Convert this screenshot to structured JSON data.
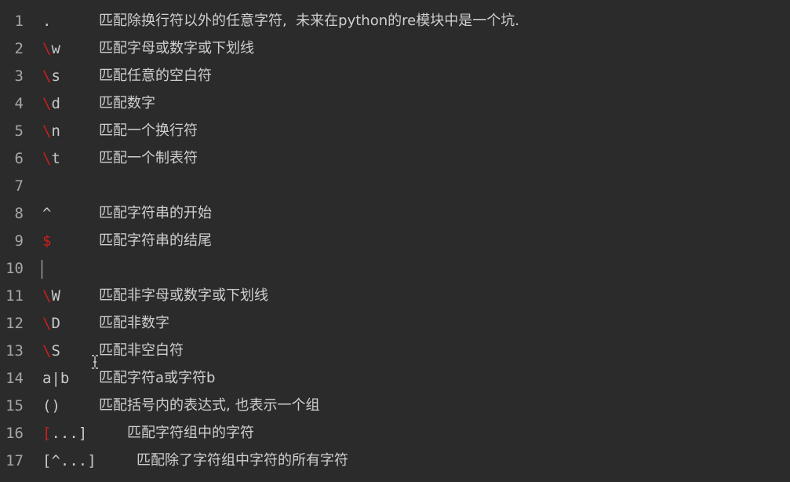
{
  "editor": {
    "lines": [
      {
        "num": "1",
        "esc": "",
        "tok": ".",
        "desc": "匹配除换行符以外的任意字符,  未来在python的re模块中是一个坑."
      },
      {
        "num": "2",
        "esc": "\\",
        "tok": "w",
        "desc": "匹配字母或数字或下划线"
      },
      {
        "num": "3",
        "esc": "\\",
        "tok": "s",
        "desc": "匹配任意的空白符"
      },
      {
        "num": "4",
        "esc": "\\",
        "tok": "d",
        "desc": "匹配数字"
      },
      {
        "num": "5",
        "esc": "\\",
        "tok": "n",
        "desc": "匹配一个换行符"
      },
      {
        "num": "6",
        "esc": "\\",
        "tok": "t",
        "desc": "匹配一个制表符"
      },
      {
        "num": "7",
        "esc": "",
        "tok": "",
        "desc": ""
      },
      {
        "num": "8",
        "esc": "",
        "tok": "^",
        "desc": "匹配字符串的开始"
      },
      {
        "num": "9",
        "esc": "$",
        "tok": "",
        "desc": "匹配字符串的结尾"
      },
      {
        "num": "10",
        "esc": "",
        "tok": "",
        "desc": ""
      },
      {
        "num": "11",
        "esc": "\\",
        "tok": "W",
        "desc": "匹配非字母或数字或下划线"
      },
      {
        "num": "12",
        "esc": "\\",
        "tok": "D",
        "desc": "匹配非数字"
      },
      {
        "num": "13",
        "esc": "\\",
        "tok": "S",
        "desc": "匹配非空白符"
      },
      {
        "num": "14",
        "esc": "",
        "tok": "a|b",
        "desc": "匹配字符a或字符b"
      },
      {
        "num": "15",
        "esc": "",
        "tok": "()",
        "desc": "匹配括号内的表达式, 也表示一个组"
      },
      {
        "num": "16",
        "esc": "[",
        "tok": "...]",
        "desc": "匹配字符组中的字符"
      },
      {
        "num": "17",
        "esc": "",
        "tok": "[^...]",
        "desc": "匹配除了字符组中字符的所有字符"
      }
    ]
  },
  "colors": {
    "background": "#2b2b2b",
    "line_number": "#a6a6a6",
    "text": "#cfcfcf",
    "escape": "#c8201e"
  },
  "cursor": {
    "line": "10"
  },
  "mouse": {
    "icon": "text-cursor-icon"
  }
}
